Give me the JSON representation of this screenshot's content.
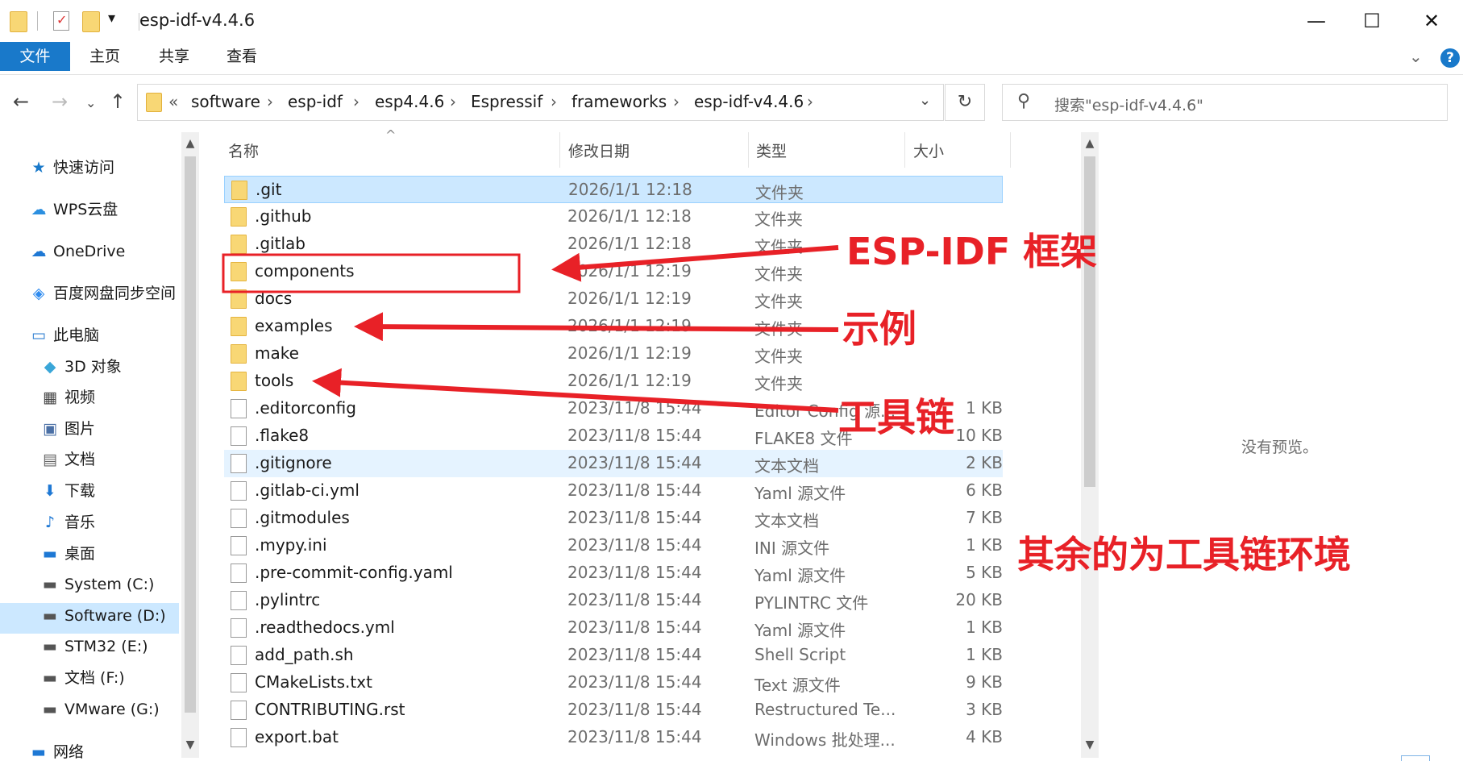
{
  "window": {
    "title": "esp-idf-v4.4.6",
    "qa_dropdown": "▾",
    "minimize": "—",
    "maximize": "☐",
    "close": "✕"
  },
  "ribbon": {
    "tabs": [
      "文件",
      "主页",
      "共享",
      "查看"
    ],
    "expand": "⌄",
    "help": "?"
  },
  "nav": {
    "back": "←",
    "forward": "→",
    "recent": "⌄",
    "up": "↑"
  },
  "address": {
    "overflow": "«",
    "crumbs": [
      "software",
      "esp-idf",
      "esp4.4.6",
      "Espressif",
      "frameworks",
      "esp-idf-v4.4.6"
    ],
    "separator": "›",
    "dropdown": "⌄",
    "refresh": "↻"
  },
  "search": {
    "icon": "search-icon",
    "placeholder": "搜索\"esp-idf-v4.4.6\""
  },
  "sidebar": {
    "items": [
      {
        "label": "快速访问",
        "icon": "star-icon",
        "glyph": "★"
      },
      {
        "label": "WPS云盘",
        "icon": "cloud-icon",
        "glyph": "☁"
      },
      {
        "label": "OneDrive",
        "icon": "onedrive-icon",
        "glyph": "☁"
      },
      {
        "label": "百度网盘同步空间",
        "icon": "baidu-icon",
        "glyph": "◈"
      },
      {
        "label": "此电脑",
        "icon": "computer-icon",
        "glyph": "▭"
      },
      {
        "label": "3D 对象",
        "icon": "cube-icon",
        "glyph": "◆"
      },
      {
        "label": "视频",
        "icon": "video-icon",
        "glyph": "▦"
      },
      {
        "label": "图片",
        "icon": "picture-icon",
        "glyph": "▣"
      },
      {
        "label": "文档",
        "icon": "document-icon",
        "glyph": "▤"
      },
      {
        "label": "下载",
        "icon": "download-icon",
        "glyph": "⬇"
      },
      {
        "label": "音乐",
        "icon": "music-icon",
        "glyph": "♪"
      },
      {
        "label": "桌面",
        "icon": "desktop-icon",
        "glyph": "▬"
      },
      {
        "label": "System (C:)",
        "icon": "drive-icon",
        "glyph": "▬"
      },
      {
        "label": "Software (D:)",
        "icon": "drive-icon",
        "glyph": "▬"
      },
      {
        "label": "STM32 (E:)",
        "icon": "drive-icon",
        "glyph": "▬"
      },
      {
        "label": "文档 (F:)",
        "icon": "drive-icon",
        "glyph": "▬"
      },
      {
        "label": "VMware (G:)",
        "icon": "drive-icon",
        "glyph": "▬"
      },
      {
        "label": "网络",
        "icon": "network-icon",
        "glyph": "▬"
      }
    ]
  },
  "columns": {
    "name": "名称",
    "date": "修改日期",
    "type": "类型",
    "size": "大小",
    "sort": "^"
  },
  "files": [
    {
      "name": ".git",
      "date": "2026/1/1 12:18",
      "type": "文件夹",
      "size": "",
      "icon": "folder-icon"
    },
    {
      "name": ".github",
      "date": "2026/1/1 12:18",
      "type": "文件夹",
      "size": "",
      "icon": "folder-icon"
    },
    {
      "name": ".gitlab",
      "date": "2026/1/1 12:18",
      "type": "文件夹",
      "size": "",
      "icon": "folder-icon"
    },
    {
      "name": "components",
      "date": "2026/1/1 12:19",
      "type": "文件夹",
      "size": "",
      "icon": "folder-icon"
    },
    {
      "name": "docs",
      "date": "2026/1/1 12:19",
      "type": "文件夹",
      "size": "",
      "icon": "folder-icon"
    },
    {
      "name": "examples",
      "date": "2026/1/1 12:19",
      "type": "文件夹",
      "size": "",
      "icon": "folder-icon"
    },
    {
      "name": "make",
      "date": "2026/1/1 12:19",
      "type": "文件夹",
      "size": "",
      "icon": "folder-icon"
    },
    {
      "name": "tools",
      "date": "2026/1/1 12:19",
      "type": "文件夹",
      "size": "",
      "icon": "folder-icon"
    },
    {
      "name": ".editorconfig",
      "date": "2023/11/8 15:44",
      "type": "Editor Config 源...",
      "size": "1 KB",
      "icon": "settings-file-icon"
    },
    {
      "name": ".flake8",
      "date": "2023/11/8 15:44",
      "type": "FLAKE8 文件",
      "size": "10 KB",
      "icon": "file-icon"
    },
    {
      "name": ".gitignore",
      "date": "2023/11/8 15:44",
      "type": "文本文档",
      "size": "2 KB",
      "icon": "text-file-icon"
    },
    {
      "name": ".gitlab-ci.yml",
      "date": "2023/11/8 15:44",
      "type": "Yaml 源文件",
      "size": "6 KB",
      "icon": "yaml-file-icon"
    },
    {
      "name": ".gitmodules",
      "date": "2023/11/8 15:44",
      "type": "文本文档",
      "size": "7 KB",
      "icon": "text-file-icon"
    },
    {
      "name": ".mypy.ini",
      "date": "2023/11/8 15:44",
      "type": "INI 源文件",
      "size": "1 KB",
      "icon": "settings-file-icon"
    },
    {
      "name": ".pre-commit-config.yaml",
      "date": "2023/11/8 15:44",
      "type": "Yaml 源文件",
      "size": "5 KB",
      "icon": "yaml-file-icon"
    },
    {
      "name": ".pylintrc",
      "date": "2023/11/8 15:44",
      "type": "PYLINTRC 文件",
      "size": "20 KB",
      "icon": "file-icon"
    },
    {
      "name": ".readthedocs.yml",
      "date": "2023/11/8 15:44",
      "type": "Yaml 源文件",
      "size": "1 KB",
      "icon": "yaml-file-icon"
    },
    {
      "name": "add_path.sh",
      "date": "2023/11/8 15:44",
      "type": "Shell Script",
      "size": "1 KB",
      "icon": "script-file-icon"
    },
    {
      "name": "CMakeLists.txt",
      "date": "2023/11/8 15:44",
      "type": "Text 源文件",
      "size": "9 KB",
      "icon": "text-file-icon"
    },
    {
      "name": "CONTRIBUTING.rst",
      "date": "2023/11/8 15:44",
      "type": "Restructured Te...",
      "size": "3 KB",
      "icon": "file-icon"
    },
    {
      "name": "export.bat",
      "date": "2023/11/8 15:44",
      "type": "Windows 批处理...",
      "size": "4 KB",
      "icon": "script-file-icon"
    }
  ],
  "preview": {
    "empty_text": "没有预览。"
  },
  "annotations": {
    "framework": "ESP-IDF 框架",
    "examples": "示例",
    "toolchain": "工具链",
    "rest": "其余的为工具链环境",
    "color": "#e82127"
  },
  "colors": {
    "accent": "#1979ca",
    "selection": "#cce8ff",
    "folder": "#f8d775"
  }
}
